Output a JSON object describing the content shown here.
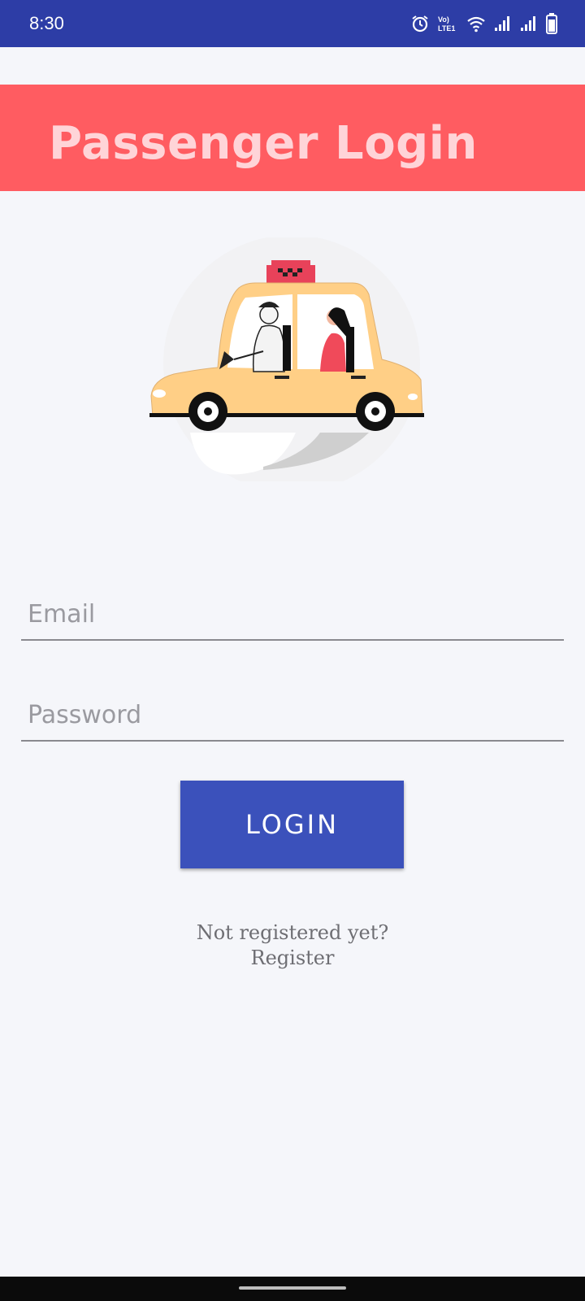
{
  "status_bar": {
    "time": "8:30",
    "icons": [
      "alarm-icon",
      "volte-icon",
      "wifi-icon",
      "signal-icon",
      "signal-icon",
      "battery-icon"
    ],
    "volte_text": "VoLTE1"
  },
  "header": {
    "title": "Passenger Login",
    "background_color": "#ff5c61",
    "title_color": "#ffd4d8"
  },
  "illustration": {
    "taxi_sign_color": "#e8425a",
    "car_color": "#ffcf86"
  },
  "form": {
    "email_placeholder": "Email",
    "email_value": "",
    "password_placeholder": "Password",
    "password_value": "",
    "login_label": "LOGIN",
    "login_color": "#3b51bb"
  },
  "register": {
    "prompt": "Not registered yet?",
    "link_label": "Register"
  }
}
